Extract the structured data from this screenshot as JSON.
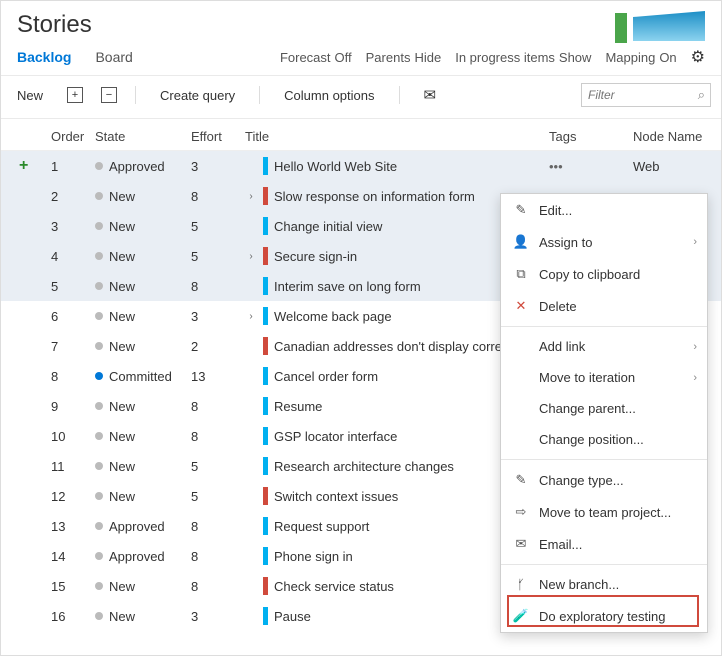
{
  "pageTitle": "Stories",
  "tabs": {
    "backlog": "Backlog",
    "board": "Board"
  },
  "options": {
    "forecast": {
      "label": "Forecast",
      "value": "Off"
    },
    "parents": {
      "label": "Parents",
      "value": "Hide"
    },
    "inProgress": {
      "label": "In progress items",
      "value": "Show"
    },
    "mapping": {
      "label": "Mapping",
      "value": "On"
    }
  },
  "toolbar": {
    "new": "New",
    "createQuery": "Create query",
    "columnOptions": "Column options"
  },
  "filter": {
    "placeholder": "Filter"
  },
  "columns": {
    "order": "Order",
    "state": "State",
    "effort": "Effort",
    "title": "Title",
    "tags": "Tags",
    "node": "Node Name"
  },
  "rows": [
    {
      "order": "1",
      "state": "Approved",
      "stateColor": "grey",
      "effort": "3",
      "title": "Hello World Web Site",
      "color": "cyan",
      "chev": false,
      "node": "Web",
      "sel": true,
      "showEllipsis": true,
      "showAdd": true
    },
    {
      "order": "2",
      "state": "New",
      "stateColor": "grey",
      "effort": "8",
      "title": "Slow response on information form",
      "color": "red",
      "chev": true,
      "sel": true
    },
    {
      "order": "3",
      "state": "New",
      "stateColor": "grey",
      "effort": "5",
      "title": "Change initial view",
      "color": "cyan",
      "chev": false,
      "sel": true
    },
    {
      "order": "4",
      "state": "New",
      "stateColor": "grey",
      "effort": "5",
      "title": "Secure sign-in",
      "color": "red",
      "chev": true,
      "sel": true
    },
    {
      "order": "5",
      "state": "New",
      "stateColor": "grey",
      "effort": "8",
      "title": "Interim save on long form",
      "color": "cyan",
      "chev": false,
      "sel": true
    },
    {
      "order": "6",
      "state": "New",
      "stateColor": "grey",
      "effort": "3",
      "title": "Welcome back page",
      "color": "cyan",
      "chev": true
    },
    {
      "order": "7",
      "state": "New",
      "stateColor": "grey",
      "effort": "2",
      "title": "Canadian addresses don't display correctly",
      "color": "red",
      "chev": false
    },
    {
      "order": "8",
      "state": "Committed",
      "stateColor": "blue",
      "effort": "13",
      "title": "Cancel order form",
      "color": "cyan",
      "chev": false
    },
    {
      "order": "9",
      "state": "New",
      "stateColor": "grey",
      "effort": "8",
      "title": "Resume",
      "color": "cyan",
      "chev": false
    },
    {
      "order": "10",
      "state": "New",
      "stateColor": "grey",
      "effort": "8",
      "title": "GSP locator interface",
      "color": "cyan",
      "chev": false
    },
    {
      "order": "11",
      "state": "New",
      "stateColor": "grey",
      "effort": "5",
      "title": "Research architecture changes",
      "color": "cyan",
      "chev": false
    },
    {
      "order": "12",
      "state": "New",
      "stateColor": "grey",
      "effort": "5",
      "title": "Switch context issues",
      "color": "red",
      "chev": false
    },
    {
      "order": "13",
      "state": "Approved",
      "stateColor": "grey",
      "effort": "8",
      "title": "Request support",
      "color": "cyan",
      "chev": false
    },
    {
      "order": "14",
      "state": "Approved",
      "stateColor": "grey",
      "effort": "8",
      "title": "Phone sign in",
      "color": "cyan",
      "chev": false
    },
    {
      "order": "15",
      "state": "New",
      "stateColor": "grey",
      "effort": "8",
      "title": "Check service status",
      "color": "red",
      "chev": false
    },
    {
      "order": "16",
      "state": "New",
      "stateColor": "grey",
      "effort": "3",
      "title": "Pause",
      "color": "cyan",
      "chev": false
    }
  ],
  "menu": [
    {
      "icon": "✎",
      "label": "Edit...",
      "name": "menu-edit"
    },
    {
      "icon": "👤",
      "label": "Assign to",
      "arrow": true,
      "name": "menu-assign-to"
    },
    {
      "icon": "⧉",
      "label": "Copy to clipboard",
      "name": "menu-copy"
    },
    {
      "icon": "✕",
      "label": "Delete",
      "red": true,
      "name": "menu-delete"
    },
    {
      "divider": true
    },
    {
      "icon": "",
      "label": "Add link",
      "arrow": true,
      "name": "menu-add-link"
    },
    {
      "icon": "",
      "label": "Move to iteration",
      "arrow": true,
      "name": "menu-move-iteration"
    },
    {
      "icon": "",
      "label": "Change parent...",
      "name": "menu-change-parent"
    },
    {
      "icon": "",
      "label": "Change position...",
      "name": "menu-change-position"
    },
    {
      "divider": true
    },
    {
      "icon": "✎",
      "label": "Change type...",
      "name": "menu-change-type"
    },
    {
      "icon": "⇨",
      "label": "Move to team project...",
      "name": "menu-move-team-project"
    },
    {
      "icon": "✉",
      "label": "Email...",
      "name": "menu-email"
    },
    {
      "divider": true
    },
    {
      "icon": "ᚶ",
      "label": "New branch...",
      "name": "menu-new-branch"
    },
    {
      "icon": "🧪",
      "label": "Do exploratory testing",
      "name": "menu-exploratory-testing"
    }
  ]
}
